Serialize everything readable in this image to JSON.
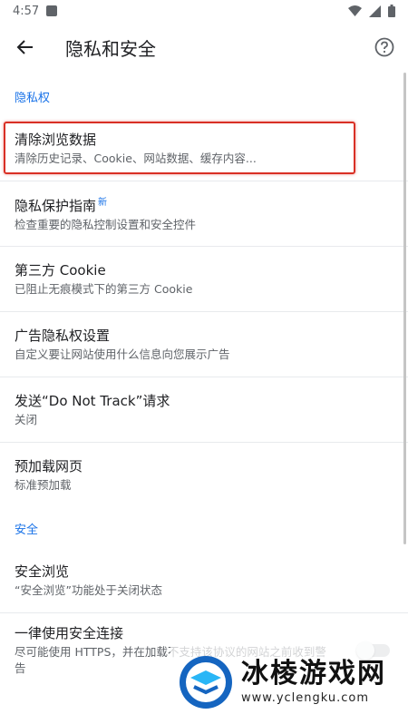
{
  "status_bar": {
    "time": "4:57"
  },
  "app_bar": {
    "title": "隐私和安全"
  },
  "sections": {
    "privacy": "隐私权",
    "security": "安全"
  },
  "privacy_items": [
    {
      "title": "清除浏览数据",
      "subtitle": "清除历史记录、Cookie、网站数据、缓存内容..."
    },
    {
      "title": "隐私保护指南",
      "badge": "新",
      "subtitle": "检查重要的隐私控制设置和安全控件"
    },
    {
      "title": "第三方 Cookie",
      "subtitle": "已阻止无痕模式下的第三方 Cookie"
    },
    {
      "title": "广告隐私权设置",
      "subtitle": "自定义要让网站使用什么信息向您展示广告"
    },
    {
      "title": "发送“Do Not Track”请求",
      "subtitle": "关闭"
    },
    {
      "title": "预加载网页",
      "subtitle": "标准预加载"
    }
  ],
  "security_items": [
    {
      "title": "安全浏览",
      "subtitle": "“安全浏览”功能处于关闭状态"
    },
    {
      "title": "一律使用安全连接",
      "subtitle": "尽可能使用 HTTPS，并在加载不支持该协议的网站之前收到警告",
      "toggle_on": false
    }
  ],
  "watermark": {
    "name": "冰棱游戏网",
    "url": "www.yclengku.com"
  },
  "colors": {
    "accent": "#1a73e8",
    "highlight": "#d93025",
    "divider": "#e8eaed"
  },
  "icons": {
    "back": "arrow-left-icon",
    "help": "help-circle-icon",
    "wifi": "wifi-icon",
    "signal": "signal-icon",
    "battery": "battery-icon"
  }
}
